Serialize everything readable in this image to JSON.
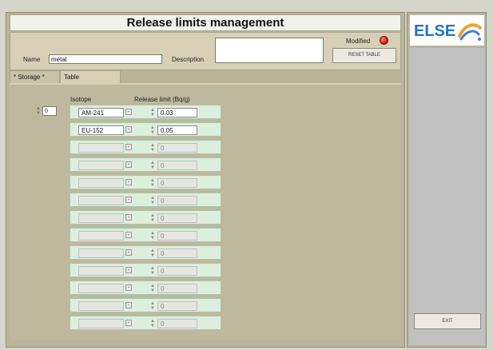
{
  "window": {
    "title": "Release limits management"
  },
  "header": {
    "name_label": "Name",
    "name_value": "metal",
    "description_label": "Description",
    "description_value": "",
    "modified_label": "Modified",
    "reset_button": "RESET TABLE",
    "modified_indicator_color": "#e02020"
  },
  "tabs": [
    {
      "label": "* Storage *"
    },
    {
      "label": "Table"
    }
  ],
  "table": {
    "index_value": "0",
    "columns": {
      "isotope": "Isotope",
      "limit": "Release limit (Bq/g)"
    },
    "rows": [
      {
        "isotope": "AM-241",
        "limit": "0.03"
      },
      {
        "isotope": "EU-152",
        "limit": "0.05"
      },
      {
        "isotope": "",
        "limit": "0"
      },
      {
        "isotope": "",
        "limit": "0"
      },
      {
        "isotope": "",
        "limit": "0"
      },
      {
        "isotope": "",
        "limit": "0"
      },
      {
        "isotope": "",
        "limit": "0"
      },
      {
        "isotope": "",
        "limit": "0"
      },
      {
        "isotope": "",
        "limit": "0"
      },
      {
        "isotope": "",
        "limit": "0"
      },
      {
        "isotope": "",
        "limit": "0"
      },
      {
        "isotope": "",
        "limit": "0"
      },
      {
        "isotope": "",
        "limit": "0"
      }
    ]
  },
  "sidebar": {
    "logo_text": "ELSE",
    "logo_colors": {
      "text": "#1e73c8",
      "swirl_orange": "#f0a030",
      "swirl_blue": "#4a7fd0"
    },
    "exit_button": "EXIT"
  }
}
